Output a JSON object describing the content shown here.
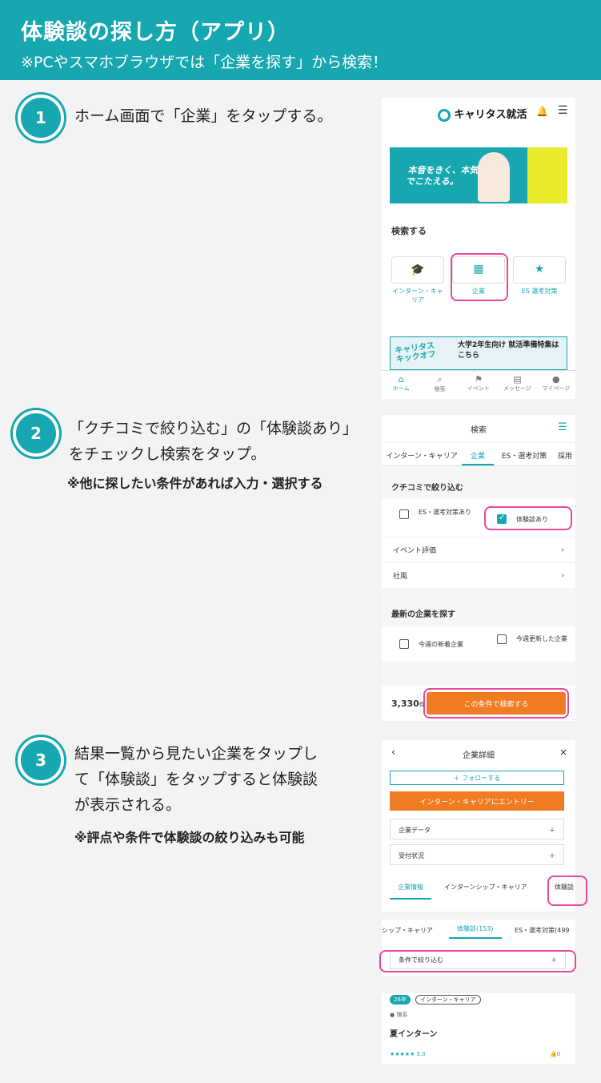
{
  "header": {
    "title": "体験談の探し方（アプリ）",
    "subtitle": "※PCやスマホブラウザでは「企業を探す」から検索！"
  },
  "steps": [
    {
      "num": "1",
      "text": "ホーム画面で「企業」をタップする。"
    },
    {
      "num": "2",
      "line1": "「クチコミで絞り込む」の「体験談あり」",
      "line2": "をチェックし検索をタップ。",
      "note": "※他に探したい条件があれば入力・選択する"
    },
    {
      "num": "3",
      "line1": "結果一覧から見たい企業をタップし",
      "line2": "て「体験談」をタップすると体験談",
      "line3": "が表示される。",
      "note": "※評点や条件で体験談の絞り込みも可能"
    }
  ],
  "screen1": {
    "logo": "キャリタス就活",
    "banner_text": "本音をきく、本気でこたえる。",
    "search_heading": "検索する",
    "search_items": [
      {
        "label": "インターン・キャリア",
        "icon": "graduation-cap-icon"
      },
      {
        "label": "企業",
        "icon": "building-icon"
      },
      {
        "label": "ES 選考対策",
        "icon": "badge-icon"
      }
    ],
    "promo_text": "大学2年生向け 就活準備特集はこちら",
    "promo_brand": "キャリタス キックオフ",
    "nav": [
      {
        "label": "ホーム",
        "icon": "home-icon"
      },
      {
        "label": "検索",
        "icon": "search-icon"
      },
      {
        "label": "イベント",
        "icon": "flag-icon"
      },
      {
        "label": "メッセージ",
        "icon": "message-icon"
      },
      {
        "label": "マイページ",
        "icon": "user-icon"
      }
    ]
  },
  "screen2": {
    "title": "検索",
    "tabs": [
      "インターン・キャリア",
      "企業",
      "ES・選考対策",
      "採用"
    ],
    "section1": "クチコミで絞り込む",
    "check1": "ES・選考対策あり",
    "check2": "体験談あり",
    "row1": "イベント評価",
    "row2": "社風",
    "section2": "最新の企業を探す",
    "check3": "今週の新着企業",
    "check4": "今週更新した企業",
    "count": "3,330",
    "count_unit": "件",
    "button": "この条件で検索する"
  },
  "screen3": {
    "title": "企業詳細",
    "follow": "＋ フォローする",
    "entry": "インターン・キャリアにエントリー",
    "row1": "企業データ",
    "row2": "受付状況",
    "tabs": [
      "企業情報",
      "インターンシップ・キャリア",
      "体験談"
    ],
    "tabs2": [
      "シップ・キャリア",
      "体験談(153)",
      "ES・選考対策(499"
    ],
    "filter": "条件で絞り込む",
    "tag1": "26卒",
    "tag2": "インターン・キャリア",
    "field": "理系",
    "item_title": "夏インターン",
    "rating": "★★★★★ 5.0",
    "likes": "0"
  },
  "colors": {
    "teal": "#16a7b0",
    "orange": "#f07b22",
    "pink": "#e8489a"
  }
}
